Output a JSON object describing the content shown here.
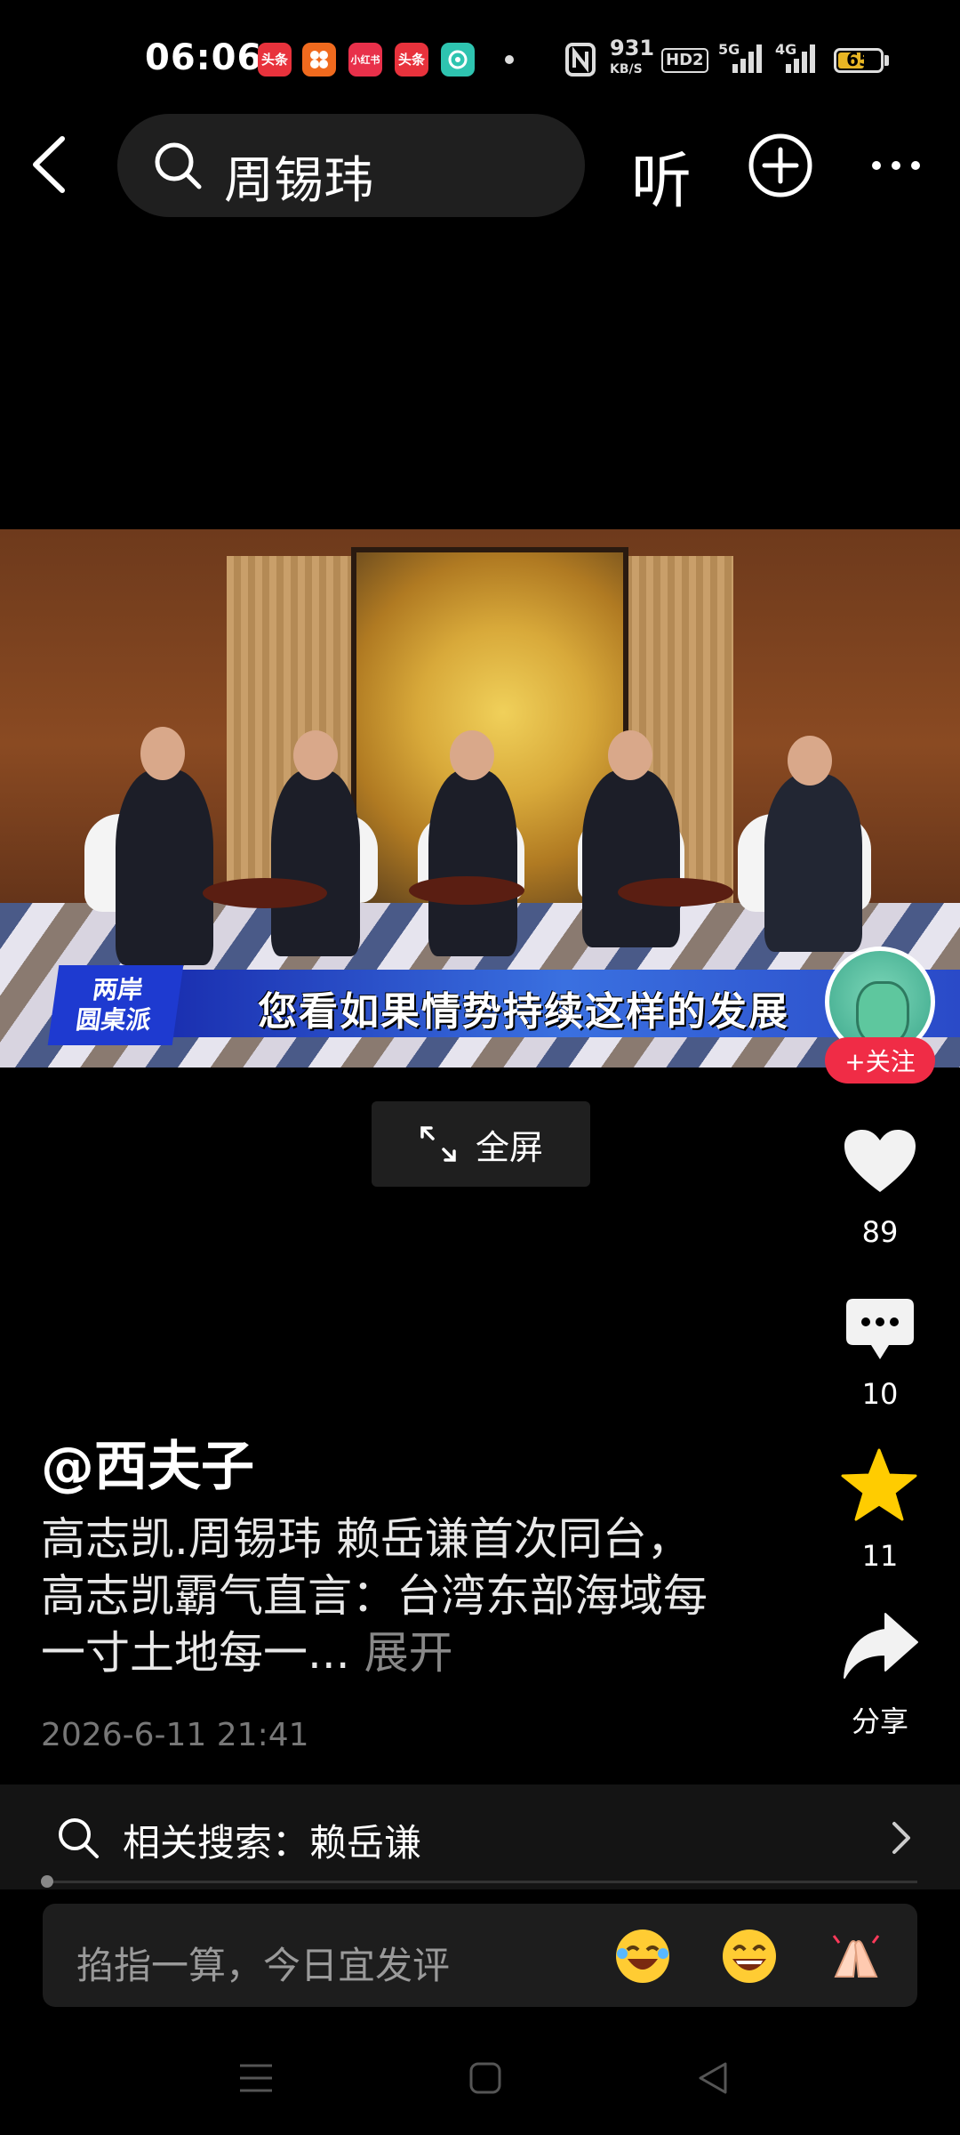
{
  "status_bar": {
    "time": "06:06",
    "app_icons": [
      {
        "name": "toutiao-app-icon",
        "text": "头条",
        "color": "#e8323c"
      },
      {
        "name": "orange-app-icon",
        "text": "",
        "color": "#f06a1e"
      },
      {
        "name": "xiaohongshu-app-icon",
        "text": "小红书",
        "color": "#e8304a"
      },
      {
        "name": "toutiao-lite-app-icon",
        "text": "头条",
        "color": "#e8323c"
      },
      {
        "name": "teal-app-icon",
        "text": "",
        "color": "#2ec4b0"
      }
    ],
    "network_speed": "931",
    "network_unit": "KB/S",
    "hd_label": "HD2",
    "net_5g": "5G",
    "net_4g": "4G",
    "battery": "65",
    "battery_level": 0.65
  },
  "top_bar": {
    "search_query": "周锡玮",
    "listen_label": "听"
  },
  "video": {
    "show_logo_line1": "两岸",
    "show_logo_line2": "圆桌派",
    "subtitle": "您看如果情势持续这样的发展",
    "follow_label": "+关注"
  },
  "fullscreen_label": "全屏",
  "actions": {
    "likes": "89",
    "comments": "10",
    "favorites": "11",
    "share_label": "分享"
  },
  "post": {
    "username": "@西夫子",
    "description": "高志凯.周锡玮 赖岳谦首次同台，高志凯霸气直言：台湾东部海域每一寸土地每一...",
    "expand_label": "展开",
    "timestamp": "2026-6-11 21:41"
  },
  "related_search": {
    "prefix": "相关搜索：",
    "term": "赖岳谦"
  },
  "comment_input": {
    "placeholder": "掐指一算，今日宜发评"
  },
  "colors": {
    "accent_red": "#f02c46",
    "star_yellow": "#ffcc00",
    "background": "#000000"
  }
}
